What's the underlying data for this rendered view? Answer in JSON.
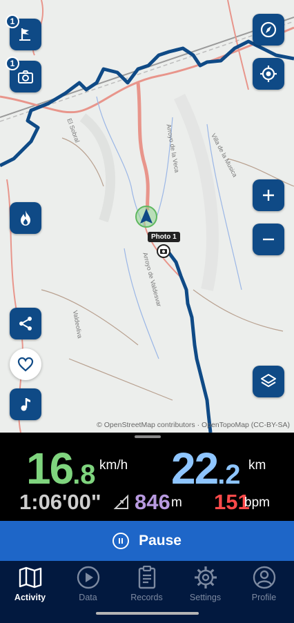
{
  "map": {
    "attribution": "© OpenStreetMap contributors · OpenTopoMap (CC-BY-SA)",
    "photo_label": "Photo 1",
    "labels": [
      "El Sobral",
      "Villa de la Musica",
      "Arroyo de la Veca",
      "Arroyo de Valdesvar",
      "Valdeoliva"
    ],
    "waypoint_badge": "1",
    "photo_badge": "1"
  },
  "metrics": {
    "speed_int": "16",
    "speed_dec": ".8",
    "speed_unit": "km/h",
    "distance_int": "22",
    "distance_dec": ".2",
    "distance_unit": "km",
    "duration": "1:06'00\"",
    "elevation": "846",
    "elevation_unit": "m",
    "heart_rate": "151",
    "heart_rate_unit": "bpm"
  },
  "pause_label": "Pause",
  "nav": [
    {
      "label": "Activity",
      "icon": "map-icon",
      "active": true
    },
    {
      "label": "Data",
      "icon": "play-icon",
      "active": false
    },
    {
      "label": "Records",
      "icon": "clipboard-icon",
      "active": false
    },
    {
      "label": "Settings",
      "icon": "gear-icon",
      "active": false
    },
    {
      "label": "Profile",
      "icon": "user-icon",
      "active": false
    }
  ],
  "colors": {
    "button": "#0f4a86",
    "speed": "#7fd47e",
    "distance": "#8ec5ff",
    "elevation": "#b89ae0",
    "heart_rate": "#ff4a4a",
    "pause_bar": "#1e66c8",
    "nav_bg": "#02193f",
    "track": "#0f4a86"
  }
}
